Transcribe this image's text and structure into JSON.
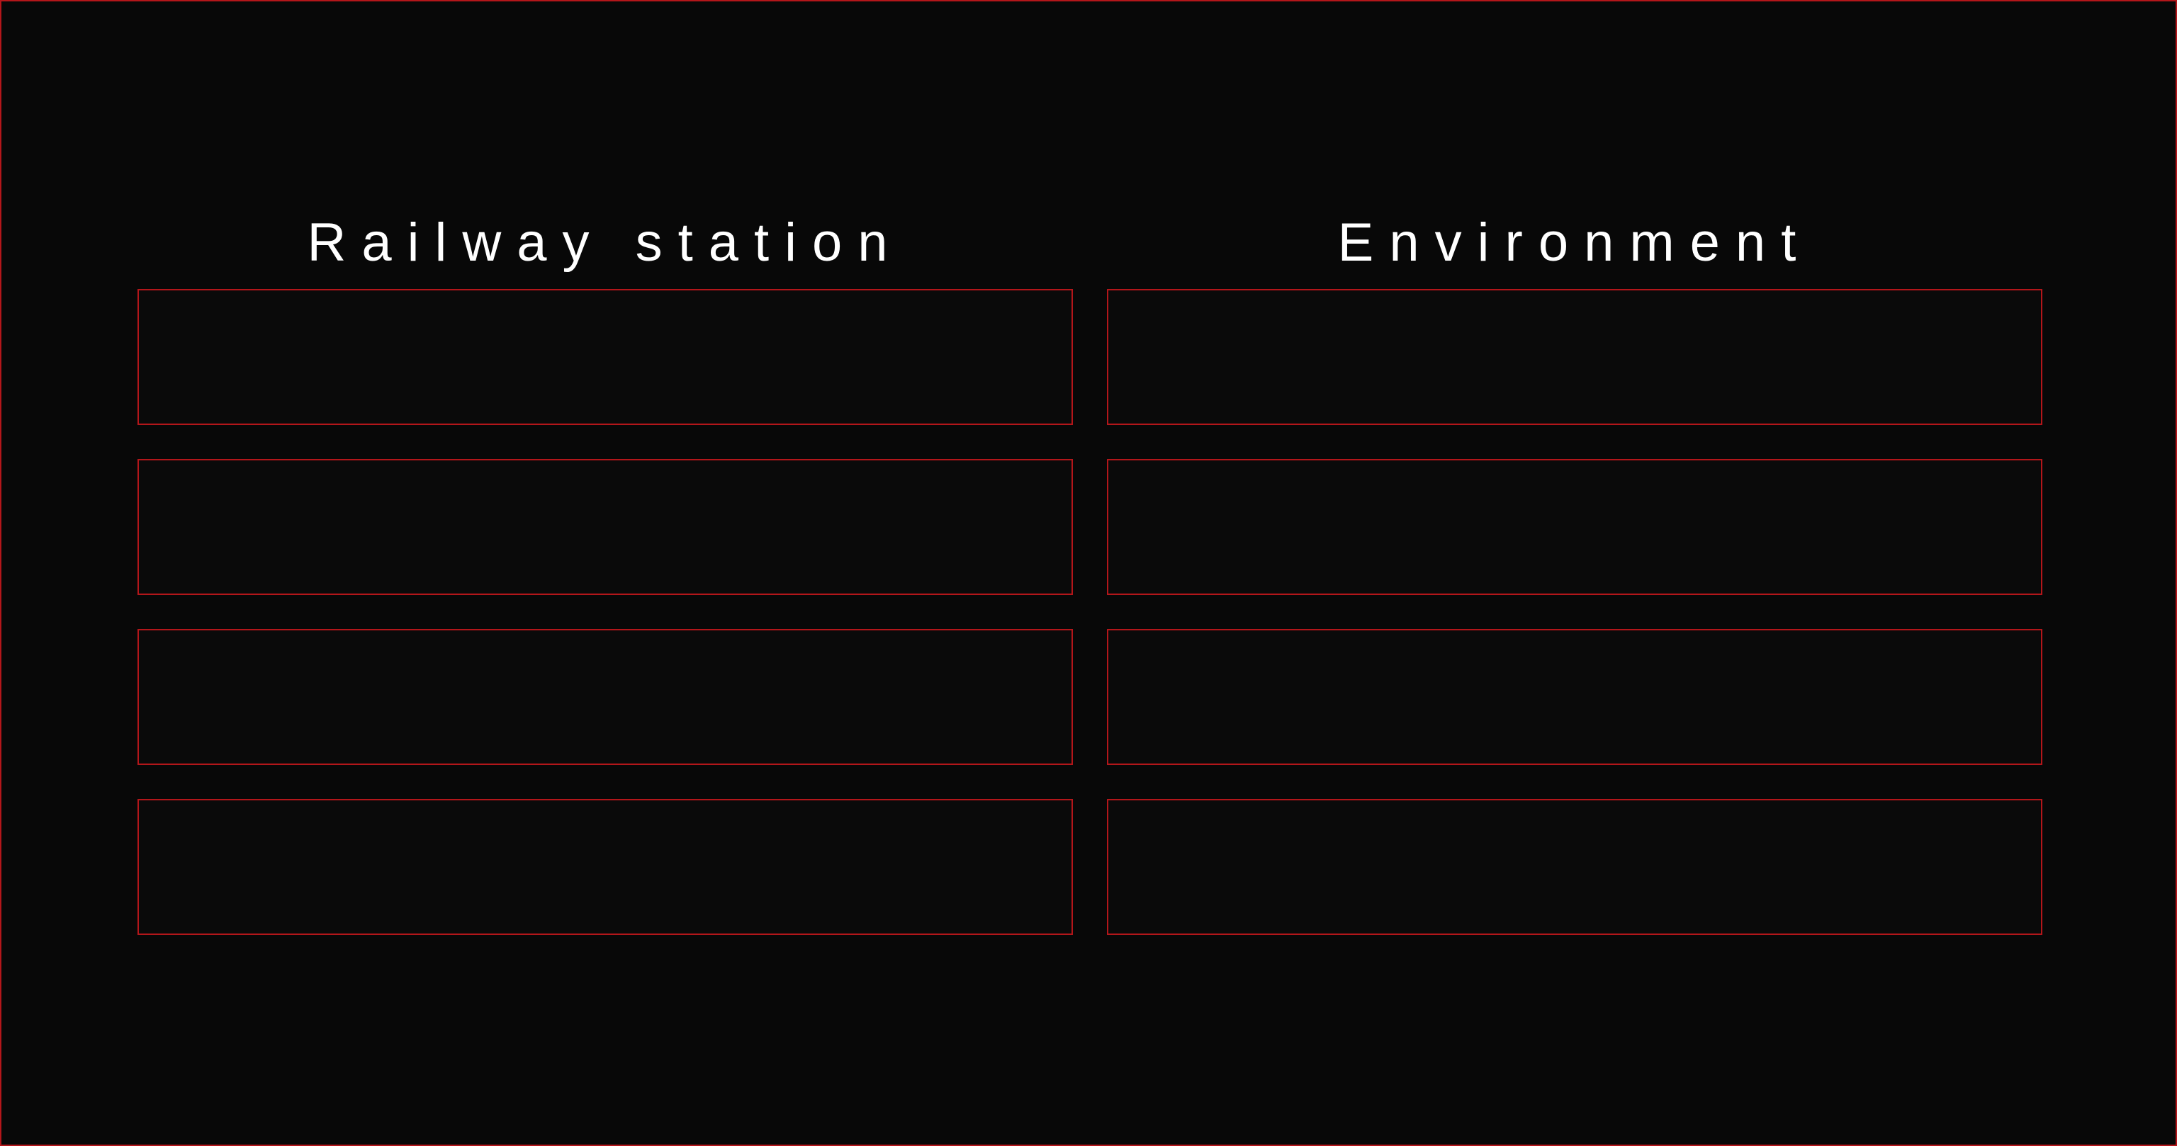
{
  "columns": [
    {
      "title": "Railway station",
      "slots": [
        "",
        "",
        "",
        ""
      ]
    },
    {
      "title": "Environment",
      "slots": [
        "",
        "",
        "",
        ""
      ]
    }
  ],
  "colors": {
    "background": "#080808",
    "slot_border": "#b3161a",
    "heading_text": "#ffffff"
  }
}
